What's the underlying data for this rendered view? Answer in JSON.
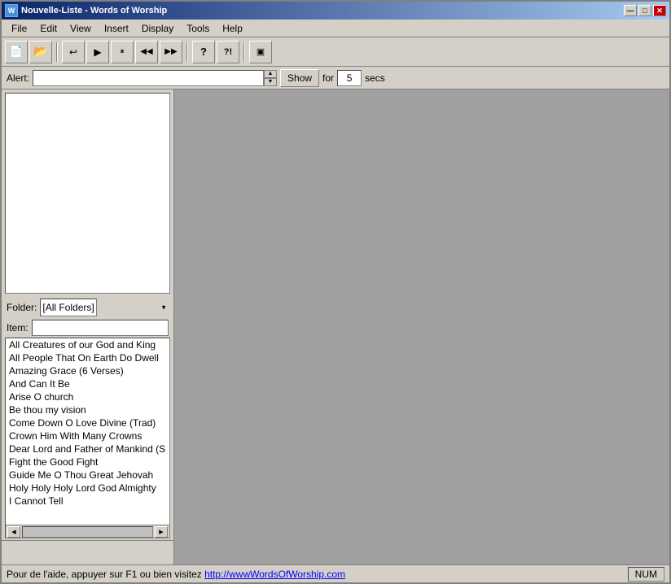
{
  "window": {
    "title": "Nouvelle-Liste - Words of Worship",
    "icon": "W"
  },
  "titlebar_buttons": {
    "minimize": "—",
    "maximize": "□",
    "close": "✕"
  },
  "menu": {
    "items": [
      "File",
      "Edit",
      "View",
      "Insert",
      "Display",
      "Tools",
      "Help"
    ]
  },
  "toolbar": {
    "buttons": [
      {
        "name": "new",
        "icon": "📄"
      },
      {
        "name": "open",
        "icon": "📂"
      },
      {
        "name": "back",
        "icon": "↩"
      },
      {
        "name": "play",
        "icon": "▶"
      },
      {
        "name": "pause",
        "icon": "⏸"
      },
      {
        "name": "rewind",
        "icon": "⏮"
      },
      {
        "name": "forward",
        "icon": "⏭"
      },
      {
        "name": "help",
        "icon": "?"
      },
      {
        "name": "info",
        "icon": "?!"
      },
      {
        "name": "window",
        "icon": "▣"
      }
    ]
  },
  "alertbar": {
    "label": "Alert:",
    "placeholder": "",
    "show_button": "Show",
    "for_label": "for",
    "secs_value": "5",
    "secs_label": "secs"
  },
  "left_panel": {
    "folder_label": "Folder:",
    "folder_options": [
      "[All Folders]"
    ],
    "folder_selected": "[All Folders]",
    "item_label": "Item:",
    "item_value": ""
  },
  "song_list": {
    "items": [
      "All Creatures of our God and King",
      "All People That On Earth Do Dwell",
      "Amazing Grace (6 Verses)",
      "And Can It Be",
      "Arise O church",
      "Be thou my vision",
      "Come Down O Love Divine (Trad)",
      "Crown Him With Many Crowns",
      "Dear Lord and Father of Mankind (S",
      "Fight the Good Fight",
      "Guide Me O Thou Great Jehovah",
      "Holy Holy Holy Lord God Almighty",
      "I Cannot Tell"
    ]
  },
  "statusbar": {
    "help_text": "Pour de l'aide, appuyer sur F1 ou bien visitez ",
    "url": "http://wwwWordsOfWorship.com",
    "num_label": "NUM"
  }
}
